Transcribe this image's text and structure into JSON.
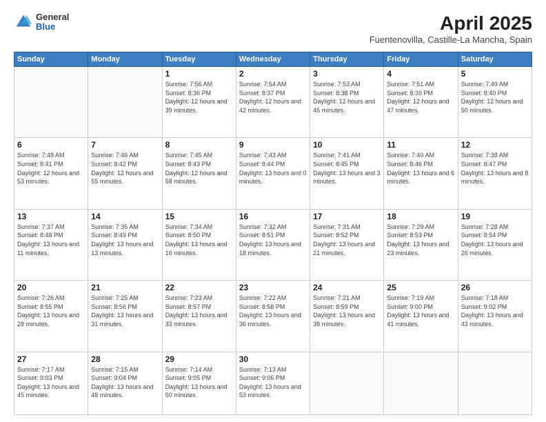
{
  "header": {
    "logo_line1": "General",
    "logo_line2": "Blue",
    "title": "April 2025",
    "subtitle": "Fuentenovilla, Castille-La Mancha, Spain"
  },
  "weekdays": [
    "Sunday",
    "Monday",
    "Tuesday",
    "Wednesday",
    "Thursday",
    "Friday",
    "Saturday"
  ],
  "days": [
    {
      "num": "",
      "sunrise": "",
      "sunset": "",
      "daylight": ""
    },
    {
      "num": "",
      "sunrise": "",
      "sunset": "",
      "daylight": ""
    },
    {
      "num": "1",
      "sunrise": "Sunrise: 7:56 AM",
      "sunset": "Sunset: 8:36 PM",
      "daylight": "Daylight: 12 hours and 39 minutes."
    },
    {
      "num": "2",
      "sunrise": "Sunrise: 7:54 AM",
      "sunset": "Sunset: 8:37 PM",
      "daylight": "Daylight: 12 hours and 42 minutes."
    },
    {
      "num": "3",
      "sunrise": "Sunrise: 7:53 AM",
      "sunset": "Sunset: 8:38 PM",
      "daylight": "Daylight: 12 hours and 45 minutes."
    },
    {
      "num": "4",
      "sunrise": "Sunrise: 7:51 AM",
      "sunset": "Sunset: 8:39 PM",
      "daylight": "Daylight: 12 hours and 47 minutes."
    },
    {
      "num": "5",
      "sunrise": "Sunrise: 7:49 AM",
      "sunset": "Sunset: 8:40 PM",
      "daylight": "Daylight: 12 hours and 50 minutes."
    },
    {
      "num": "6",
      "sunrise": "Sunrise: 7:48 AM",
      "sunset": "Sunset: 8:41 PM",
      "daylight": "Daylight: 12 hours and 53 minutes."
    },
    {
      "num": "7",
      "sunrise": "Sunrise: 7:46 AM",
      "sunset": "Sunset: 8:42 PM",
      "daylight": "Daylight: 12 hours and 55 minutes."
    },
    {
      "num": "8",
      "sunrise": "Sunrise: 7:45 AM",
      "sunset": "Sunset: 8:43 PM",
      "daylight": "Daylight: 12 hours and 58 minutes."
    },
    {
      "num": "9",
      "sunrise": "Sunrise: 7:43 AM",
      "sunset": "Sunset: 8:44 PM",
      "daylight": "Daylight: 13 hours and 0 minutes."
    },
    {
      "num": "10",
      "sunrise": "Sunrise: 7:41 AM",
      "sunset": "Sunset: 8:45 PM",
      "daylight": "Daylight: 13 hours and 3 minutes."
    },
    {
      "num": "11",
      "sunrise": "Sunrise: 7:40 AM",
      "sunset": "Sunset: 8:46 PM",
      "daylight": "Daylight: 13 hours and 6 minutes."
    },
    {
      "num": "12",
      "sunrise": "Sunrise: 7:38 AM",
      "sunset": "Sunset: 8:47 PM",
      "daylight": "Daylight: 13 hours and 8 minutes."
    },
    {
      "num": "13",
      "sunrise": "Sunrise: 7:37 AM",
      "sunset": "Sunset: 8:48 PM",
      "daylight": "Daylight: 13 hours and 11 minutes."
    },
    {
      "num": "14",
      "sunrise": "Sunrise: 7:35 AM",
      "sunset": "Sunset: 8:49 PM",
      "daylight": "Daylight: 13 hours and 13 minutes."
    },
    {
      "num": "15",
      "sunrise": "Sunrise: 7:34 AM",
      "sunset": "Sunset: 8:50 PM",
      "daylight": "Daylight: 13 hours and 16 minutes."
    },
    {
      "num": "16",
      "sunrise": "Sunrise: 7:32 AM",
      "sunset": "Sunset: 8:51 PM",
      "daylight": "Daylight: 13 hours and 18 minutes."
    },
    {
      "num": "17",
      "sunrise": "Sunrise: 7:31 AM",
      "sunset": "Sunset: 8:52 PM",
      "daylight": "Daylight: 13 hours and 21 minutes."
    },
    {
      "num": "18",
      "sunrise": "Sunrise: 7:29 AM",
      "sunset": "Sunset: 8:53 PM",
      "daylight": "Daylight: 13 hours and 23 minutes."
    },
    {
      "num": "19",
      "sunrise": "Sunrise: 7:28 AM",
      "sunset": "Sunset: 8:54 PM",
      "daylight": "Daylight: 13 hours and 26 minutes."
    },
    {
      "num": "20",
      "sunrise": "Sunrise: 7:26 AM",
      "sunset": "Sunset: 8:55 PM",
      "daylight": "Daylight: 13 hours and 28 minutes."
    },
    {
      "num": "21",
      "sunrise": "Sunrise: 7:25 AM",
      "sunset": "Sunset: 8:56 PM",
      "daylight": "Daylight: 13 hours and 31 minutes."
    },
    {
      "num": "22",
      "sunrise": "Sunrise: 7:23 AM",
      "sunset": "Sunset: 8:57 PM",
      "daylight": "Daylight: 13 hours and 33 minutes."
    },
    {
      "num": "23",
      "sunrise": "Sunrise: 7:22 AM",
      "sunset": "Sunset: 8:58 PM",
      "daylight": "Daylight: 13 hours and 36 minutes."
    },
    {
      "num": "24",
      "sunrise": "Sunrise: 7:21 AM",
      "sunset": "Sunset: 8:59 PM",
      "daylight": "Daylight: 13 hours and 38 minutes."
    },
    {
      "num": "25",
      "sunrise": "Sunrise: 7:19 AM",
      "sunset": "Sunset: 9:00 PM",
      "daylight": "Daylight: 13 hours and 41 minutes."
    },
    {
      "num": "26",
      "sunrise": "Sunrise: 7:18 AM",
      "sunset": "Sunset: 9:02 PM",
      "daylight": "Daylight: 13 hours and 43 minutes."
    },
    {
      "num": "27",
      "sunrise": "Sunrise: 7:17 AM",
      "sunset": "Sunset: 9:03 PM",
      "daylight": "Daylight: 13 hours and 45 minutes."
    },
    {
      "num": "28",
      "sunrise": "Sunrise: 7:15 AM",
      "sunset": "Sunset: 9:04 PM",
      "daylight": "Daylight: 13 hours and 48 minutes."
    },
    {
      "num": "29",
      "sunrise": "Sunrise: 7:14 AM",
      "sunset": "Sunset: 9:05 PM",
      "daylight": "Daylight: 13 hours and 50 minutes."
    },
    {
      "num": "30",
      "sunrise": "Sunrise: 7:13 AM",
      "sunset": "Sunset: 9:06 PM",
      "daylight": "Daylight: 13 hours and 53 minutes."
    },
    {
      "num": "",
      "sunrise": "",
      "sunset": "",
      "daylight": ""
    },
    {
      "num": "",
      "sunrise": "",
      "sunset": "",
      "daylight": ""
    }
  ]
}
